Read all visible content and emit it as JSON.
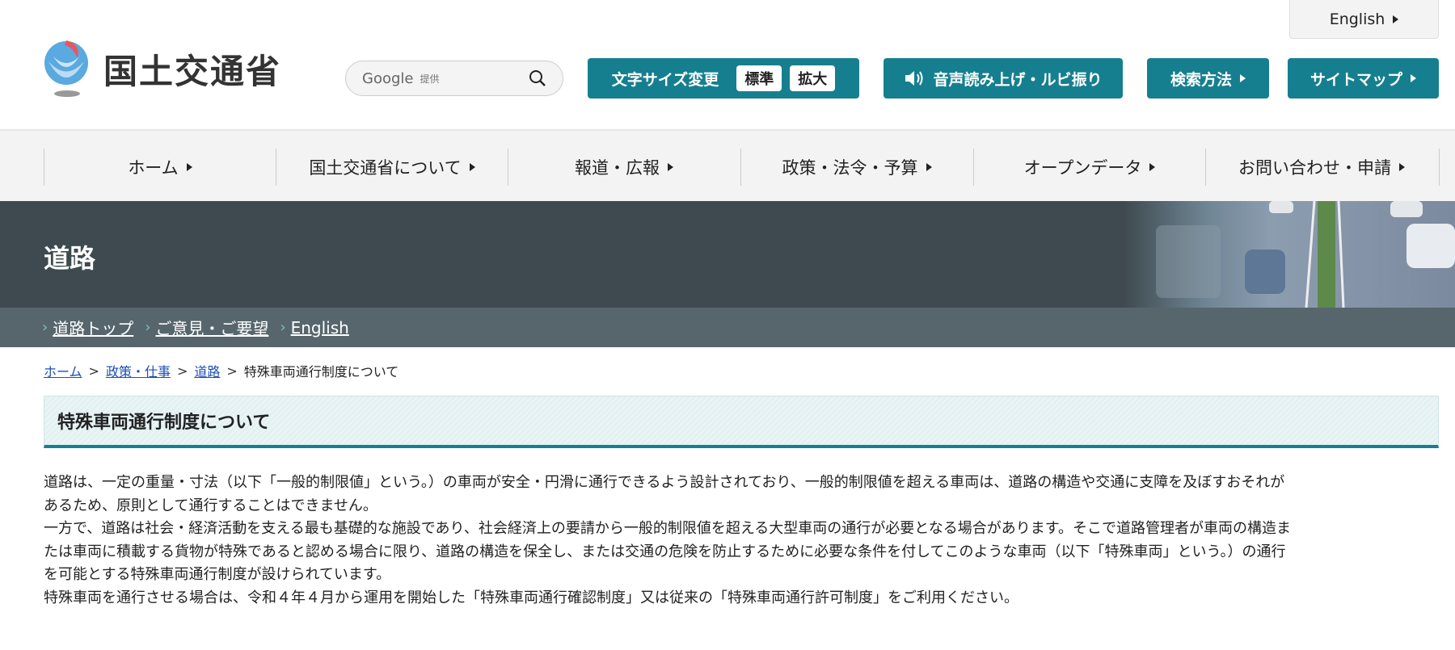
{
  "header": {
    "english_label": "English",
    "logo_text": "国土交通省",
    "search": {
      "google": "Google",
      "provided": "提供"
    },
    "font_size": {
      "label": "文字サイズ変更",
      "standard": "標準",
      "large": "拡大"
    },
    "audio_label": "音声読み上げ・ルビ振り",
    "search_method": "検索方法",
    "sitemap": "サイトマップ"
  },
  "nav": [
    "ホーム",
    "国土交通省について",
    "報道・広報",
    "政策・法令・予算",
    "オープンデータ",
    "お問い合わせ・申請"
  ],
  "banner": {
    "title": "道路"
  },
  "subnav": [
    "道路トップ",
    "ご意見・ご要望",
    "English"
  ],
  "breadcrumb": {
    "links": [
      "ホーム",
      "政策・仕事",
      "道路"
    ],
    "current": "特殊車両通行制度について"
  },
  "page_title": "特殊車両通行制度について",
  "body_lines": [
    "道路は、一定の重量・寸法（以下「一般的制限値」という。）の車両が安全・円滑に通行できるよう設計されており、一般的制限値を超える車両は、道路の構造や交通に支障を及ぼすおそれが",
    "あるため、原則として通行することはできません。",
    "一方で、道路は社会・経済活動を支える最も基礎的な施設であり、社会経済上の要請から一般的制限値を超える大型車両の通行が必要となる場合があります。そこで道路管理者が車両の構造ま",
    "たは車両に積載する貨物が特殊であると認める場合に限り、道路の構造を保全し、または交通の危険を防止するために必要な条件を付してこのような車両（以下「特殊車両」という。）の通行",
    "を可能とする特殊車両通行制度が設けられています。",
    "特殊車両を通行させる場合は、令和４年４月から運用を開始した「特殊車両通行確認制度」又は従来の「特殊車両通行許可制度」をご利用ください。"
  ],
  "colors": {
    "accent": "#167f8f",
    "banner": "#3e4a4f",
    "subnav": "#57666c",
    "link": "#1a4fb5"
  }
}
